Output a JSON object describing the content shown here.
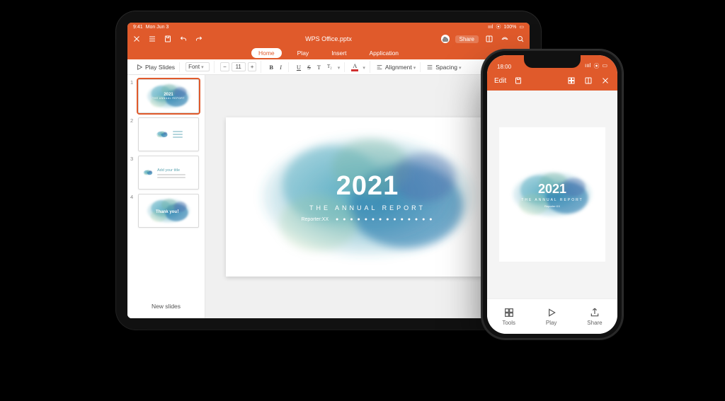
{
  "tablet": {
    "status": {
      "time": "9:41",
      "date": "Mon Jun 3",
      "wifi": "●●●",
      "battery": "100%"
    },
    "header": {
      "title": "WPS Office.pptx",
      "share_label": "Share"
    },
    "tabs": {
      "items": [
        "Home",
        "Play",
        "Insert",
        "Application"
      ],
      "active_index": 0
    },
    "toolbar": {
      "play_slides": "Play Slides",
      "font_label": "Font",
      "font_size": "11",
      "bold": "B",
      "italic": "I",
      "underline": "U",
      "strike": "S",
      "t1": "T",
      "t2": "T₂",
      "a_color": "A",
      "alignment": "Alignment",
      "spacing": "Spacing"
    },
    "thumbs": {
      "items": [
        {
          "num": "1",
          "title": "2021",
          "sub": "THE ANNUAL REPORT"
        },
        {
          "num": "2",
          "title": "",
          "sub": ""
        },
        {
          "num": "3",
          "title": "Add your title",
          "sub": ""
        },
        {
          "num": "4",
          "title": "Thank you！",
          "sub": ""
        }
      ],
      "new_slides": "New slides"
    },
    "slide": {
      "year": "2021",
      "subtitle": "THE ANNUAL REPORT",
      "reporter_label": "Reporter:",
      "reporter_value": "XX",
      "dots": "● ● ● ● ● ● ● ● ● ● ● ● ● ●"
    }
  },
  "phone": {
    "status": {
      "time": "18:00",
      "signal": "▮▮▮▮",
      "wifi": "⦿",
      "battery": "▭"
    },
    "header": {
      "edit": "Edit"
    },
    "slide": {
      "year": "2021",
      "subtitle": "THE ANNUAL REPORT",
      "reporter": "Reporter:XX"
    },
    "bottom": {
      "tools": "Tools",
      "play": "Play",
      "share": "Share"
    }
  }
}
